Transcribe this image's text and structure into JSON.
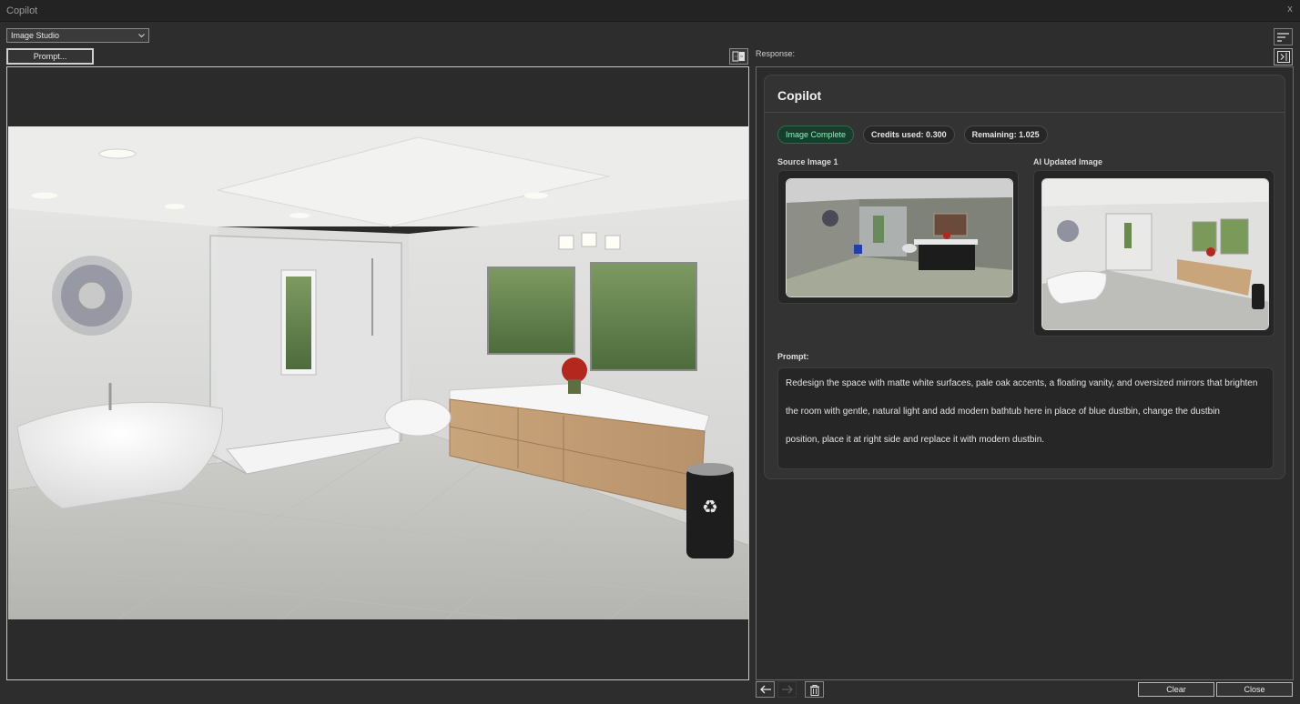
{
  "window": {
    "title": "Copilot",
    "close_glyph": "x"
  },
  "toolbar": {
    "mode_select": {
      "value": "Image Studio",
      "icon": "chevron-down-icon"
    },
    "prompt_button": "Prompt...",
    "swap_icon": "compare-swap-icon"
  },
  "response": {
    "label": "Response:",
    "sort_icon": "sort-lines-icon",
    "collapse_icon": "collapse-panel-icon",
    "card": {
      "title": "Copilot",
      "badges": [
        {
          "text": "Image Complete",
          "status": "success",
          "color": "#8ff0c0"
        },
        {
          "text": "Credits used: 0.300"
        },
        {
          "text": "Remaining: 1.025"
        }
      ],
      "source_label": "Source Image 1",
      "updated_label": "AI Updated Image",
      "prompt_label": "Prompt:",
      "prompt_lines": [
        "Redesign the space with matte white surfaces, pale oak accents, a floating vanity, and oversized mirrors that brighten",
        "the room with gentle, natural light and add modern bathtub here in place of blue dustbin, change the dustbin",
        "position, place it at right side and replace it with modern dustbin."
      ]
    }
  },
  "footer": {
    "back_icon": "arrow-left-icon",
    "forward_icon": "arrow-right-icon",
    "trash_icon": "trash-icon",
    "clear_label": "Clear",
    "close_label": "Close"
  }
}
